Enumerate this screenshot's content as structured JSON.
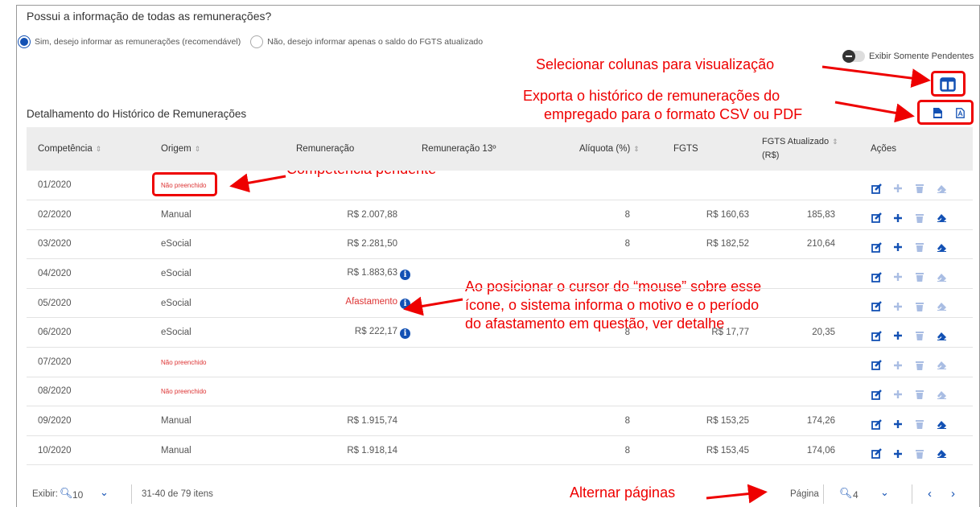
{
  "question": "Possui a informação de todas as remunerações?",
  "radios": {
    "yes": "Sim, desejo informar as remunerações (recomendável)",
    "no": "Não, desejo informar apenas o saldo do FGTS atualizado"
  },
  "toggle_label": "Exibir Somente Pendentes",
  "section_title": "Detalhamento do Histórico de Remunerações",
  "annotations": {
    "columns": "Selecionar colunas para visualização",
    "export_1": "Exporta o histórico de remunerações do",
    "export_2": "empregado para o formato CSV ou PDF",
    "pending": "Competência pendente",
    "cursor_1": "Ao posicionar o cursor do “mouse” sobre esse",
    "cursor_2": "ícone, o sistema informa o motivo e o período",
    "cursor_3": "do afastamento em questão, ver detalhe",
    "pages": "Alternar páginas"
  },
  "table": {
    "headers": {
      "competencia": "Competência",
      "origem": "Origem",
      "remuneracao": "Remuneração",
      "remuneracao13": "Remuneração 13º",
      "aliquota": "Alíquota (%)",
      "fgts": "FGTS",
      "fgts_atual_1": "FGTS Atualizado",
      "fgts_atual_2": "(R$)",
      "acoes": "Ações"
    },
    "rows": [
      {
        "competencia": "01/2020",
        "origem": "Não preenchido",
        "remuneracao": "",
        "aliquota": "",
        "fgts": "",
        "fgts_atual": ""
      },
      {
        "competencia": "02/2020",
        "origem": "Manual",
        "remuneracao": "R$ 2.007,88",
        "aliquota": "8",
        "fgts": "R$ 160,63",
        "fgts_atual": "185,83"
      },
      {
        "competencia": "03/2020",
        "origem": "eSocial",
        "remuneracao": "R$ 2.281,50",
        "aliquota": "8",
        "fgts": "R$ 182,52",
        "fgts_atual": "210,64"
      },
      {
        "competencia": "04/2020",
        "origem": "eSocial",
        "remuneracao": "R$ 1.883,63",
        "aliquota": "",
        "fgts": "",
        "fgts_atual": ""
      },
      {
        "competencia": "05/2020",
        "origem": "eSocial",
        "remuneracao": "Afastamento",
        "aliquota": "",
        "fgts": "",
        "fgts_atual": ""
      },
      {
        "competencia": "06/2020",
        "origem": "eSocial",
        "remuneracao": "R$ 222,17",
        "aliquota": "8",
        "fgts": "R$ 17,77",
        "fgts_atual": "20,35"
      },
      {
        "competencia": "07/2020",
        "origem": "Não preenchido",
        "remuneracao": "",
        "aliquota": "",
        "fgts": "",
        "fgts_atual": ""
      },
      {
        "competencia": "08/2020",
        "origem": "Não preenchido",
        "remuneracao": "",
        "aliquota": "",
        "fgts": "",
        "fgts_atual": ""
      },
      {
        "competencia": "09/2020",
        "origem": "Manual",
        "remuneracao": "R$ 1.915,74",
        "aliquota": "8",
        "fgts": "R$ 153,25",
        "fgts_atual": "174,26"
      },
      {
        "competencia": "10/2020",
        "origem": "Manual",
        "remuneracao": "R$ 1.918,14",
        "aliquota": "8",
        "fgts": "R$ 153,45",
        "fgts_atual": "174,06"
      }
    ]
  },
  "footer": {
    "show_label": "Exibir:",
    "page_size": "10",
    "range": "31-40 de 79 itens",
    "page_label": "Página",
    "page": "4"
  }
}
